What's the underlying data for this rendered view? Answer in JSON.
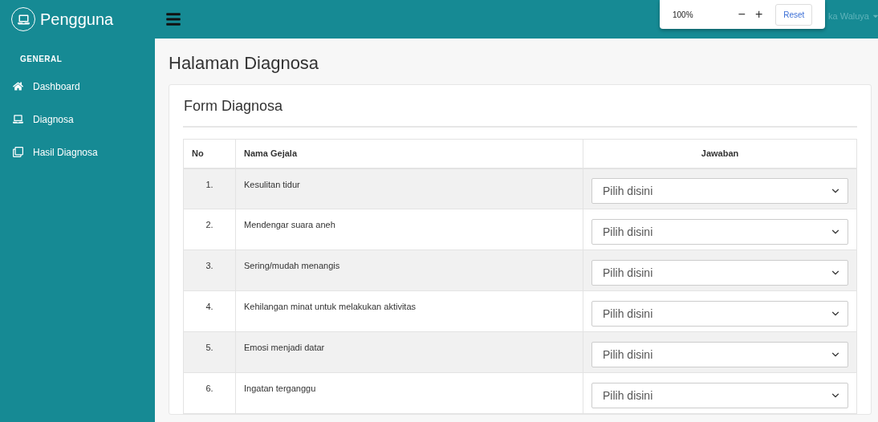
{
  "sidebar": {
    "brand": "Pengguna",
    "section": "GENERAL",
    "items": [
      {
        "label": "Dashboard",
        "selected": false
      },
      {
        "label": "Diagnosa",
        "selected": false
      },
      {
        "label": "Hasil Diagnosa",
        "selected": false
      }
    ]
  },
  "topbar": {
    "user_name": "ka Waluya"
  },
  "zoom_popup": {
    "level": "100%",
    "minus": "−",
    "plus": "+",
    "reset": "Reset"
  },
  "page_title": "Halaman Diagnosa",
  "form": {
    "title": "Form Diagnosa",
    "columns": [
      "No",
      "Nama Gejala",
      "Jawaban"
    ],
    "rows": [
      {
        "no": "1.",
        "symptom": "Kesulitan tidur",
        "placeholder": "Pilih disini"
      },
      {
        "no": "2.",
        "symptom": "Mendengar suara aneh",
        "placeholder": "Pilih disini"
      },
      {
        "no": "3.",
        "symptom": "Sering/mudah menangis",
        "placeholder": "Pilih disini"
      },
      {
        "no": "4.",
        "symptom": "Kehilangan minat untuk melakukan aktivitas",
        "placeholder": "Pilih disini"
      },
      {
        "no": "5.",
        "symptom": "Emosi menjadi datar",
        "placeholder": "Pilih disini"
      },
      {
        "no": "6.",
        "symptom": "Ingatan terganggu",
        "placeholder": "Pilih disini"
      }
    ]
  }
}
